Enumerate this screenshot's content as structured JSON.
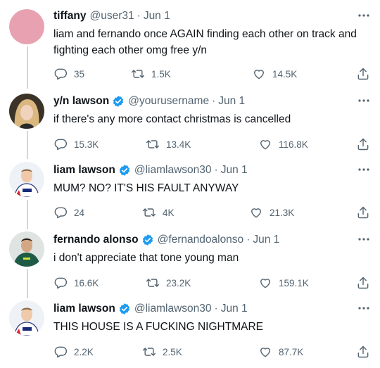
{
  "tweets": [
    {
      "name": "tiffany",
      "verified": false,
      "handle": "@user31",
      "date": "Jun 1",
      "text": "liam and fernando once AGAIN finding each other on track and fighting each other omg free y/n",
      "replies": "35",
      "retweets": "1.5K",
      "likes": "14.5K",
      "avatar_color": "#e8a1b0"
    },
    {
      "name": "y/n lawson",
      "verified": true,
      "handle": "@yourusername",
      "date": "Jun 1",
      "text": "if there's any more contact christmas is cancelled",
      "replies": "15.3K",
      "retweets": "13.4K",
      "likes": "116.8K",
      "avatar_color": "#c9a97a"
    },
    {
      "name": "liam lawson",
      "verified": true,
      "handle": "@liamlawson30",
      "date": "Jun 1",
      "text": "MUM? NO? IT'S HIS FAULT ANYWAY",
      "replies": "24",
      "retweets": "4K",
      "likes": "21.3K",
      "avatar_color": "#dfe6ee"
    },
    {
      "name": "fernando alonso",
      "verified": true,
      "handle": "@fernandoalonso",
      "date": "Jun 1",
      "text": "i don't appreciate that tone young man",
      "replies": "16.6K",
      "retweets": "23.2K",
      "likes": "159.1K",
      "avatar_color": "#1e5b45"
    },
    {
      "name": "liam lawson",
      "verified": true,
      "handle": "@liamlawson30",
      "date": "Jun 1",
      "text": "THIS HOUSE IS A FUCKING NIGHTMARE",
      "replies": "2.2K",
      "retweets": "2.5K",
      "likes": "87.7K",
      "avatar_color": "#dfe6ee"
    }
  ],
  "colors": {
    "verified_blue": "#1d9bf0",
    "secondary_text": "#536471",
    "thread_line": "#cfd9de"
  },
  "icons": {
    "reply": "reply-icon",
    "retweet": "retweet-icon",
    "like": "heart-icon",
    "share": "share-icon",
    "more": "more-icon",
    "verified": "verified-badge-icon"
  }
}
